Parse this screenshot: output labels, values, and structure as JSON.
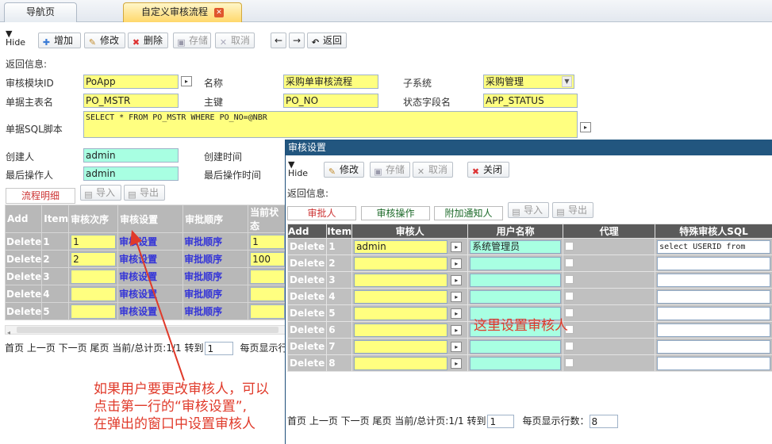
{
  "tabs": [
    {
      "label": "导航页"
    },
    {
      "label": "自定义审核流程"
    }
  ],
  "toolbar": {
    "hide": "Hide",
    "add": "增加",
    "edit": "修改",
    "delete": "删除",
    "save": "存储",
    "cancel": "取消",
    "back": "返回"
  },
  "return_info_label": "返回信息:",
  "form": {
    "audit_module_id_label": "审核模块ID",
    "audit_module_id": "PoApp",
    "name_label": "名称",
    "name": "采购单审核流程",
    "subsystem_label": "子系统",
    "subsystem": "采购管理",
    "master_table_label": "单据主表名",
    "master_table": "PO_MSTR",
    "primary_key_label": "主键",
    "primary_key": "PO_NO",
    "status_field_label": "状态字段名",
    "status_field": "APP_STATUS",
    "sql_label": "单据SQL脚本",
    "sql": "SELECT * FROM PO_MSTR WHERE PO_NO=@NBR",
    "creator_label": "创建人",
    "creator": "admin",
    "created_time_label": "创建时间",
    "last_operator_label": "最后操作人",
    "last_operator": "admin",
    "last_op_time_label": "最后操作时间"
  },
  "flow_tab": "流程明细",
  "import": "导入",
  "export": "导出",
  "main_grid": {
    "headers": [
      "Add",
      "Item",
      "审核次序",
      "审核设置",
      "审批顺序",
      "当前状态"
    ],
    "rows": [
      {
        "action": "Delete",
        "item": "1",
        "order": "1",
        "setting": "审核设置",
        "seq": "审批顺序",
        "state": "1"
      },
      {
        "action": "Delete",
        "item": "2",
        "order": "2",
        "setting": "审核设置",
        "seq": "审批顺序",
        "state": "100"
      },
      {
        "action": "Delete",
        "item": "3",
        "order": "",
        "setting": "审核设置",
        "seq": "审批顺序",
        "state": ""
      },
      {
        "action": "Delete",
        "item": "4",
        "order": "",
        "setting": "审核设置",
        "seq": "审批顺序",
        "state": ""
      },
      {
        "action": "Delete",
        "item": "5",
        "order": "",
        "setting": "审核设置",
        "seq": "审批顺序",
        "state": ""
      }
    ]
  },
  "pager_main": {
    "text": "首页 上一页 下一页 尾页 当前/总计页:1/1 转到",
    "page": "1",
    "rows_label": "每页显示行数"
  },
  "annotation_left": [
    "如果用户要更改审核人，可以",
    "点击第一行的“审核设置”,",
    "在弹出的窗口中设置审核人"
  ],
  "annotation_right": "这里设置审核人",
  "dialog": {
    "title": "审核设置",
    "hide": "Hide",
    "edit": "修改",
    "save": "存储",
    "cancel": "取消",
    "close": "关闭",
    "return_info_label": "返回信息:",
    "tabs": [
      "审批人",
      "审核操作",
      "附加通知人"
    ],
    "import": "导入",
    "export": "导出",
    "headers": [
      "Add",
      "Item",
      "审核人",
      "用户名称",
      "代理",
      "特殊审核人SQL"
    ],
    "rows": [
      {
        "action": "Delete",
        "item": "1",
        "auditor": "admin",
        "username": "系统管理员",
        "sql": "select USERID from"
      },
      {
        "action": "Delete",
        "item": "2",
        "auditor": "",
        "username": "",
        "sql": ""
      },
      {
        "action": "Delete",
        "item": "3",
        "auditor": "",
        "username": "",
        "sql": ""
      },
      {
        "action": "Delete",
        "item": "4",
        "auditor": "",
        "username": "",
        "sql": ""
      },
      {
        "action": "Delete",
        "item": "5",
        "auditor": "",
        "username": "",
        "sql": ""
      },
      {
        "action": "Delete",
        "item": "6",
        "auditor": "",
        "username": "",
        "sql": ""
      },
      {
        "action": "Delete",
        "item": "7",
        "auditor": "",
        "username": "",
        "sql": ""
      },
      {
        "action": "Delete",
        "item": "8",
        "auditor": "",
        "username": "",
        "sql": ""
      }
    ],
    "pager": {
      "text": "首页 上一页 下一页 尾页 当前/总计页:1/1 转到",
      "page": "1",
      "rows_label": "每页显示行数：",
      "rows_per_page": "8"
    }
  }
}
